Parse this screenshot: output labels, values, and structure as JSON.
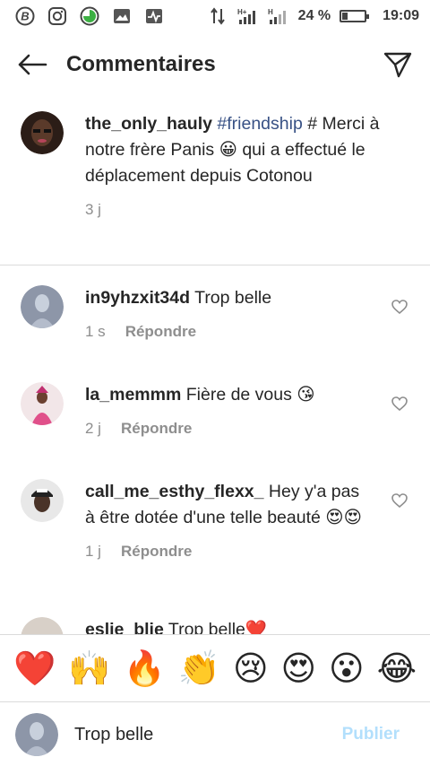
{
  "status_bar": {
    "network_icons": [
      "data-arrows-icon",
      "signal-h-plus-icon",
      "signal-h-icon"
    ],
    "battery_percent": "24 %",
    "battery_level": 0.24,
    "time": "19:09"
  },
  "header": {
    "title": "Commentaires"
  },
  "caption": {
    "username": "the_only_hauly",
    "hashtag": "#friendship",
    "hash": "#",
    "text": "Merci à notre frère Panis 😀 qui a effectué le déplacement depuis Cotonou",
    "time": "3 j"
  },
  "comments": [
    {
      "username": "in9yhzxit34d",
      "text": "Trop belle",
      "time": "1 s",
      "reply_label": "Répondre"
    },
    {
      "username": "la_memmm",
      "text": "Fière de vous 😘",
      "time": "2 j",
      "reply_label": "Répondre"
    },
    {
      "username": "call_me_esthy_flexx_",
      "text": "Hey y'a pas à être dotée d'une telle beauté 😍😍",
      "time": "1 j",
      "reply_label": "Répondre"
    },
    {
      "username": "eslie_blie",
      "text": "Trop belle❤️"
    }
  ],
  "emoji_bar": [
    "❤️",
    "🙌",
    "🔥",
    "👏",
    "😢",
    "😍",
    "😮",
    "😂"
  ],
  "compose": {
    "value": "Trop belle",
    "publish_label": "Publier"
  },
  "colors": {
    "hashtag": "#385185",
    "meta_gray": "#8e8e8e",
    "publish_disabled": "#b2dffc",
    "divider": "#dbdbdb"
  }
}
